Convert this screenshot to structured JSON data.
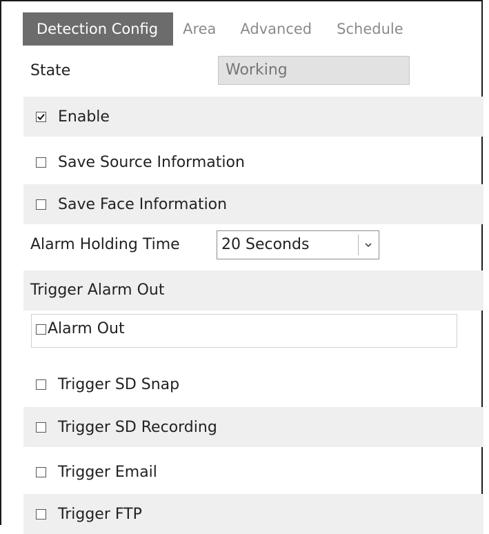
{
  "tabs": [
    {
      "label": "Detection Config",
      "active": true
    },
    {
      "label": "Area",
      "active": false
    },
    {
      "label": "Advanced",
      "active": false
    },
    {
      "label": "Schedule",
      "active": false
    }
  ],
  "state": {
    "label": "State",
    "value": "Working"
  },
  "options": {
    "enable": {
      "label": "Enable",
      "checked": true
    },
    "save_source": {
      "label": "Save Source Information",
      "checked": false
    },
    "save_face": {
      "label": "Save Face Information",
      "checked": false
    }
  },
  "alarm_holding": {
    "label": "Alarm Holding Time",
    "selected": "20 Seconds"
  },
  "trigger_alarm_out": {
    "label": "Trigger Alarm Out",
    "alarm_out": {
      "label": "Alarm Out",
      "checked": false
    }
  },
  "triggers": {
    "sd_snap": {
      "label": "Trigger SD Snap",
      "checked": false
    },
    "sd_recording": {
      "label": "Trigger SD Recording",
      "checked": false
    },
    "email": {
      "label": "Trigger Email",
      "checked": false
    },
    "ftp": {
      "label": "Trigger FTP",
      "checked": false
    }
  },
  "colors": {
    "active_tab_bg": "#6c6c6c",
    "shaded_row_bg": "#efefef",
    "state_box_bg": "#e2e2e2"
  }
}
